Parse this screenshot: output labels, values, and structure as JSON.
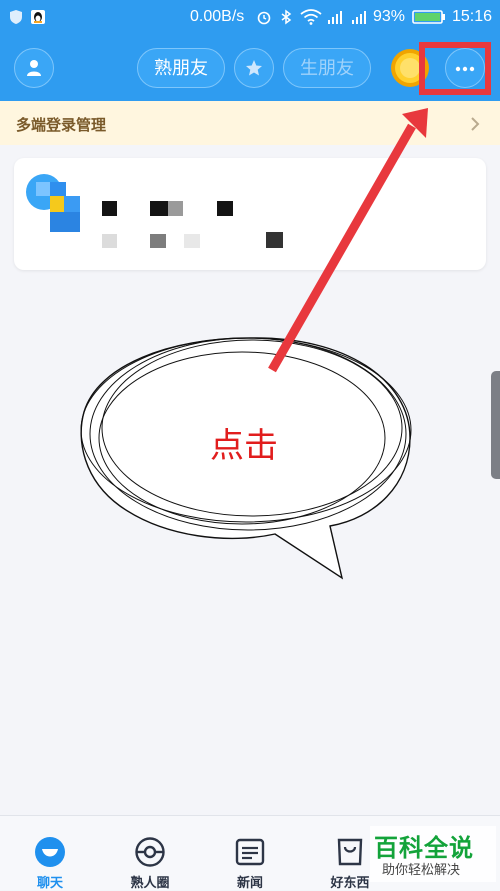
{
  "status_bar": {
    "speed": "0.00B/s",
    "battery": "93%",
    "time": "15:16"
  },
  "top_bar": {
    "tab_close_friends": "熟朋友",
    "tab_new_friends": "生朋友"
  },
  "banner": {
    "label": "多端登录管理"
  },
  "annotation": {
    "callout_text": "点击",
    "highlight_color": "#e8383d"
  },
  "bottom_nav": {
    "items": [
      {
        "label": "聊天",
        "icon": "chat-bubble-icon",
        "active": true
      },
      {
        "label": "熟人圈",
        "icon": "circle-icon",
        "active": false
      },
      {
        "label": "新闻",
        "icon": "news-icon",
        "active": false
      },
      {
        "label": "好东西",
        "icon": "shopping-bag-icon",
        "active": false
      }
    ]
  },
  "watermark": {
    "title": "百科全说",
    "subtitle": "助你轻松解决"
  },
  "colors": {
    "brand_blue": "#2f9cf0",
    "banner_bg": "#fff6df",
    "active_tab": "#1f90ee"
  }
}
